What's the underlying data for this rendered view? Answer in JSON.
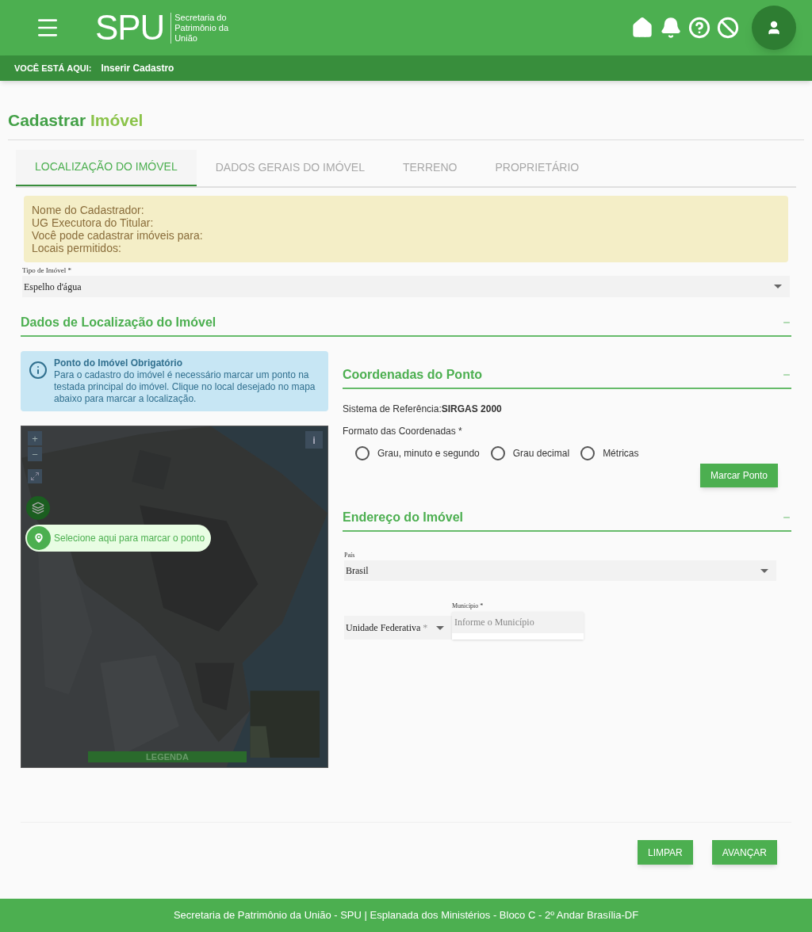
{
  "header": {
    "logo": "SPU",
    "logo_subtitle": [
      "Secretaria do",
      "Patrimônio da",
      "União"
    ]
  },
  "breadcrumb": {
    "label": "VOCÊ ESTÁ AQUI:",
    "current": "Inserir Cadastro"
  },
  "page_title": {
    "first": "Cadastrar",
    "second": "Imóvel"
  },
  "tabs": [
    {
      "label": "LOCALIZAÇÃO DO IMÓVEL",
      "selected": true
    },
    {
      "label": "DADOS GERAIS DO IMÓVEL",
      "selected": false
    },
    {
      "label": "TERRENO",
      "selected": false
    },
    {
      "label": "PROPRIETÁRIO",
      "selected": false
    }
  ],
  "notice_lines": [
    "Nome do Cadastrador:",
    "UG Executora do Titular:",
    "Você pode cadastrar imóveis para:",
    "Locais permitidos:"
  ],
  "property_type": {
    "label": "Tipo de Imóvel *",
    "value": "Espelho d'água"
  },
  "location_section": {
    "title": "Dados de Localização do Imóvel"
  },
  "info_alert": {
    "title": "Ponto do Imóvel Obrigatório",
    "text": "Para o cadastro do imóvel é necessário marcar um ponto na testada principal do imóvel. Clique no local desejado no mapa abaixo para marcar a localização."
  },
  "map": {
    "kind": "picture",
    "zoom_in": "+",
    "zoom_out": "−",
    "info": "i",
    "mark_point": "Selecione aqui para marcar o ponto",
    "legend": "LEGENDA"
  },
  "coordinates": {
    "title": "Coordenadas do Ponto",
    "reference_label": "Sistema de Referência:",
    "reference_value": "SIRGAS 2000",
    "format_label": "Formato das Coordenadas *",
    "options": [
      {
        "label": "Grau, minuto e segundo",
        "selected": false
      },
      {
        "label": "Grau decimal",
        "selected": false
      },
      {
        "label": "Métricas",
        "selected": false
      }
    ],
    "button": "Marcar Ponto"
  },
  "address": {
    "title": "Endereço do Imóvel",
    "country_label": "País",
    "country_value": "Brasil",
    "state_placeholder": "Unidade Federativa",
    "state_required": "*",
    "city_label": "Município *",
    "city_placeholder": "Informe o Município"
  },
  "actions": [
    "LIMPAR",
    "AVANÇAR"
  ],
  "footer": "Secretaria de Patrimônio da União - SPU | Esplanada dos Ministérios - Bloco C - 2º Andar Brasília-DF"
}
